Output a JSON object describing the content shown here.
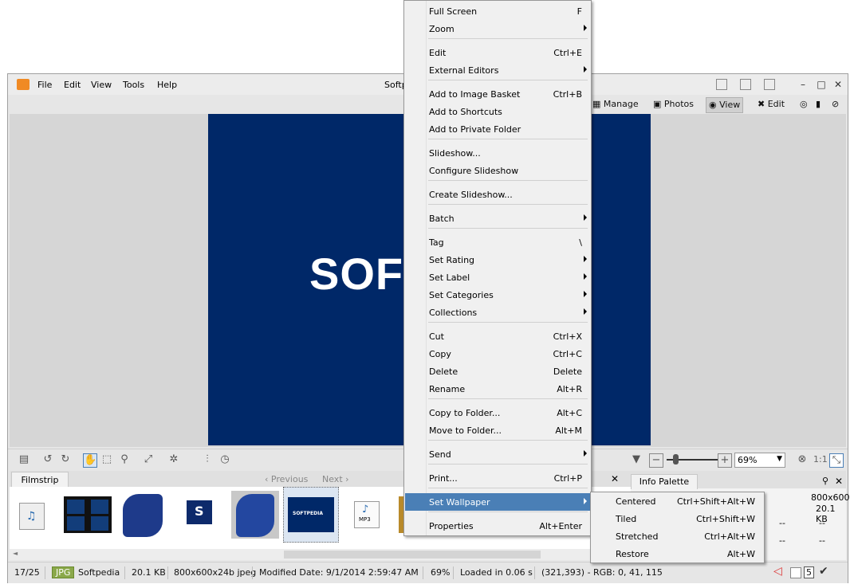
{
  "window": {
    "title": "Softpedia",
    "menu": [
      "File",
      "Edit",
      "View",
      "Tools",
      "Help"
    ],
    "modes": [
      "Manage",
      "Photos",
      "View",
      "Edit"
    ]
  },
  "photo": {
    "text": "SOFT"
  },
  "filmstrip": {
    "tab": "Filmstrip",
    "previous": "Previous",
    "next": "Next",
    "selected_thumb_text": "SOFTPEDIA",
    "mp3_label": "MP3"
  },
  "toolbar": {
    "zoom_value": "69%",
    "ratio": "1:1"
  },
  "info_palette": {
    "tab": "Info Palette",
    "dimensions": "800x600",
    "size": "20.1 KB",
    "dash1": "--",
    "dash2": "--",
    "dash3": "--",
    "dash4": "--"
  },
  "status": {
    "index": "17/25",
    "format": "JPG",
    "name": "Softpedia",
    "filesize": "20.1 KB",
    "dims": "800x600x24b jpeg",
    "modified": "Modified Date: 9/1/2014 2:59:47 AM",
    "zoom": "69%",
    "loaded": "Loaded in 0.06 s",
    "pixel": "(321,393) - RGB: 0, 41, 115",
    "count": "5"
  },
  "context_menu": {
    "items": [
      {
        "label": "Full Screen",
        "shortcut": "F"
      },
      {
        "label": "Zoom",
        "shortcut": ""
      },
      {
        "label": "Edit",
        "shortcut": "Ctrl+E"
      },
      {
        "label": "External Editors",
        "shortcut": ""
      },
      {
        "label": "Add to Image Basket",
        "shortcut": "Ctrl+B"
      },
      {
        "label": "Add to Shortcuts",
        "shortcut": ""
      },
      {
        "label": "Add to Private Folder",
        "shortcut": ""
      },
      {
        "label": "Slideshow...",
        "shortcut": ""
      },
      {
        "label": "Configure Slideshow",
        "shortcut": ""
      },
      {
        "label": "Create Slideshow...",
        "shortcut": ""
      },
      {
        "label": "Batch",
        "shortcut": ""
      },
      {
        "label": "Tag",
        "shortcut": "\\"
      },
      {
        "label": "Set Rating",
        "shortcut": ""
      },
      {
        "label": "Set Label",
        "shortcut": ""
      },
      {
        "label": "Set Categories",
        "shortcut": ""
      },
      {
        "label": "Collections",
        "shortcut": ""
      },
      {
        "label": "Cut",
        "shortcut": "Ctrl+X"
      },
      {
        "label": "Copy",
        "shortcut": "Ctrl+C"
      },
      {
        "label": "Delete",
        "shortcut": "Delete"
      },
      {
        "label": "Rename",
        "shortcut": "Alt+R"
      },
      {
        "label": "Copy to Folder...",
        "shortcut": "Alt+C"
      },
      {
        "label": "Move to Folder...",
        "shortcut": "Alt+M"
      },
      {
        "label": "Send",
        "shortcut": ""
      },
      {
        "label": "Print...",
        "shortcut": "Ctrl+P"
      },
      {
        "label": "Set Wallpaper",
        "shortcut": ""
      },
      {
        "label": "Properties",
        "shortcut": "Alt+Enter"
      }
    ]
  },
  "wallpaper_submenu": {
    "items": [
      {
        "label": "Centered",
        "shortcut": "Ctrl+Shift+Alt+W"
      },
      {
        "label": "Tiled",
        "shortcut": "Ctrl+Shift+W"
      },
      {
        "label": "Stretched",
        "shortcut": "Ctrl+Alt+W"
      },
      {
        "label": "Restore",
        "shortcut": "Alt+W"
      }
    ]
  },
  "colors": {
    "photo_bg": "#002868",
    "highlight": "#4a7fb6"
  }
}
